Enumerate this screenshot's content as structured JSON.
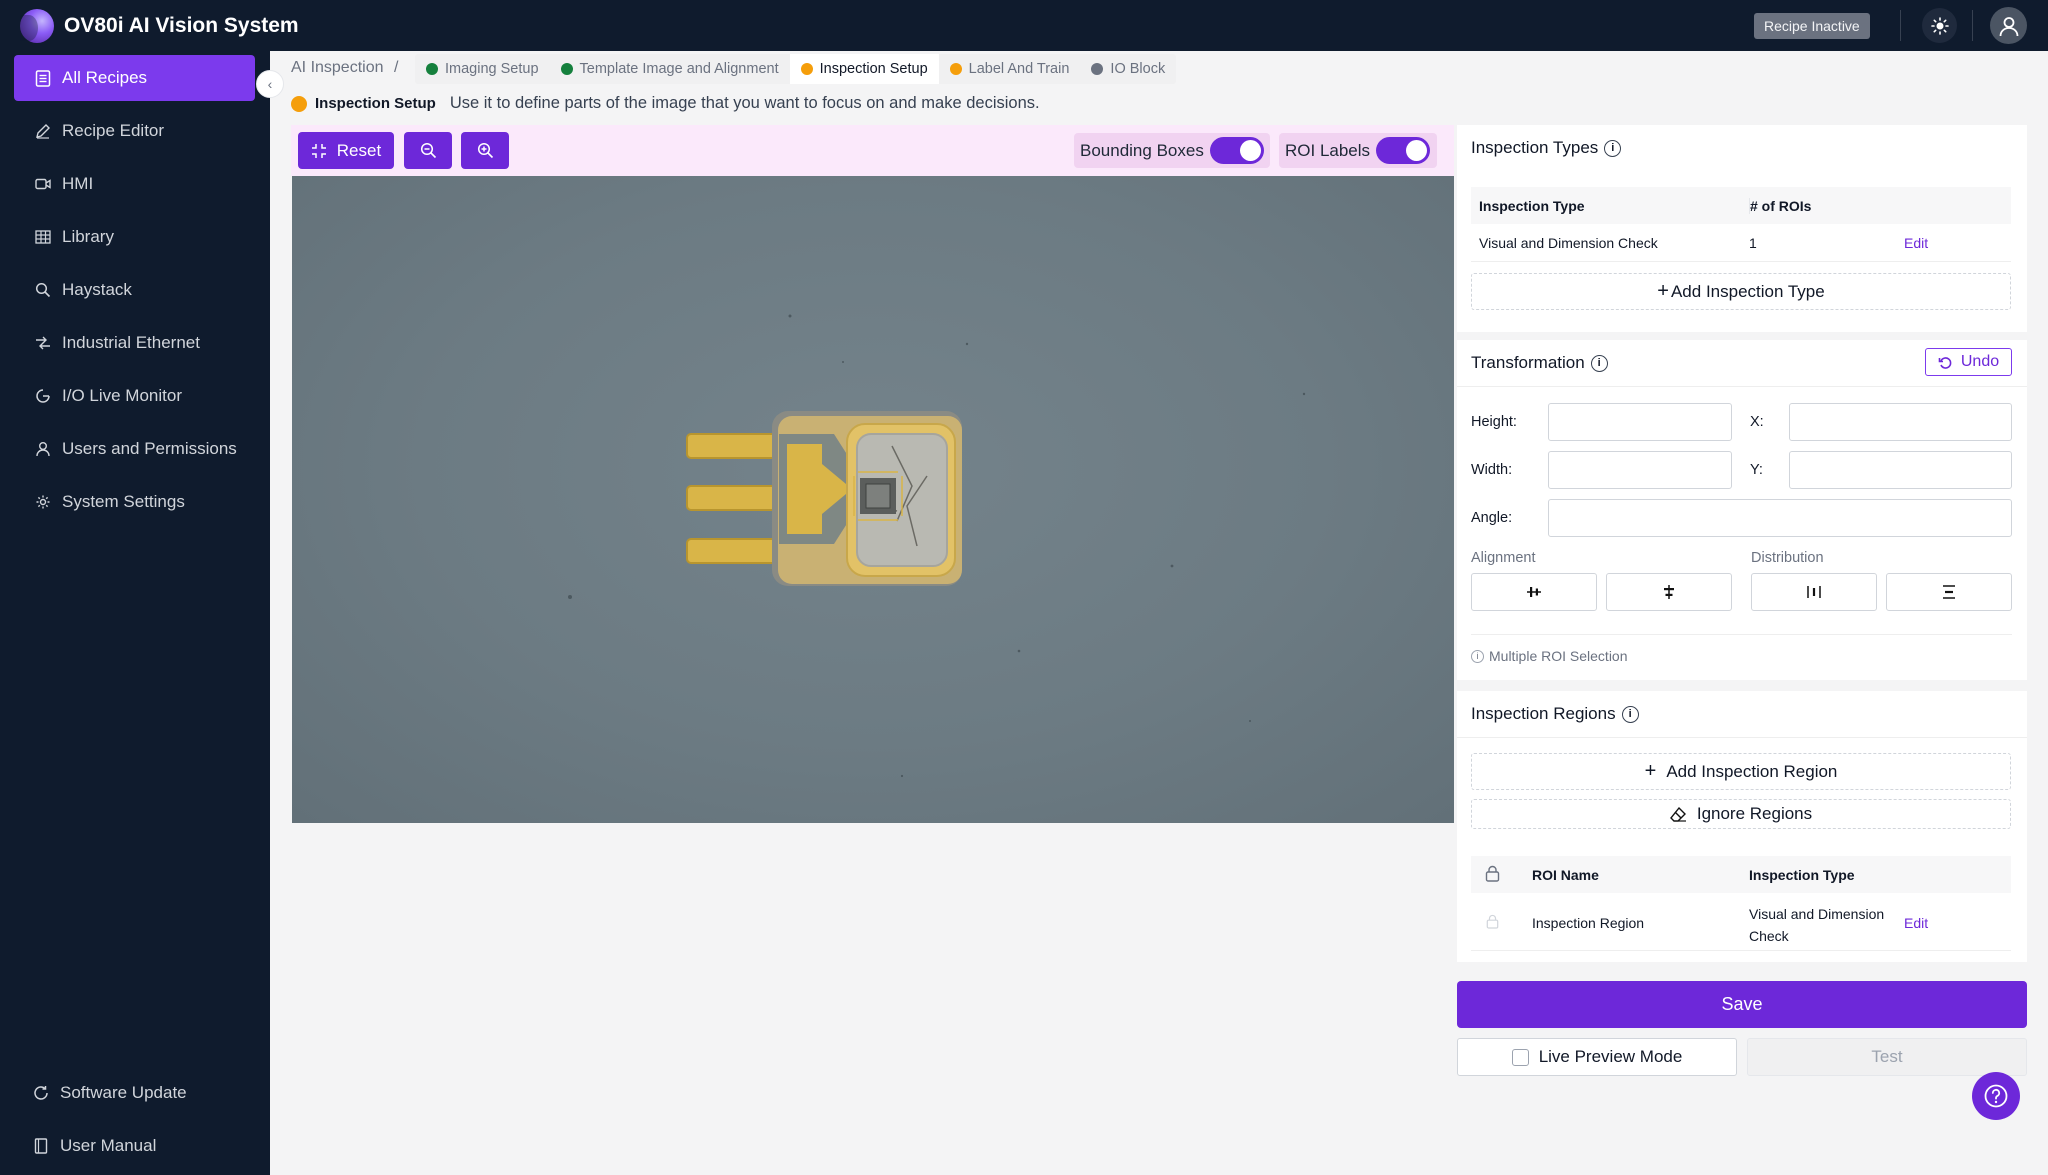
{
  "app": {
    "title": "OV80i AI Vision System",
    "recipe_status": "Recipe Inactive"
  },
  "sidebar": {
    "items": [
      {
        "label": "All Recipes",
        "icon": "list-icon",
        "active": true
      },
      {
        "label": "Recipe Editor",
        "icon": "pencil-icon"
      },
      {
        "label": "HMI",
        "icon": "video-icon"
      },
      {
        "label": "Library",
        "icon": "grid-icon"
      },
      {
        "label": "Haystack",
        "icon": "search-icon"
      },
      {
        "label": "Industrial Ethernet",
        "icon": "network-icon"
      },
      {
        "label": "I/O Live Monitor",
        "icon": "gauge-icon"
      },
      {
        "label": "Users and Permissions",
        "icon": "user-icon"
      },
      {
        "label": "System Settings",
        "icon": "gear-icon"
      }
    ],
    "bottom": [
      {
        "label": "Software Update",
        "icon": "refresh-icon"
      },
      {
        "label": "User Manual",
        "icon": "book-icon"
      }
    ]
  },
  "breadcrumb": {
    "root": "AI Inspection",
    "separator": "/",
    "steps": [
      {
        "label": "Imaging Setup",
        "color": "#15803d"
      },
      {
        "label": "Template Image and Alignment",
        "color": "#15803d"
      },
      {
        "label": "Inspection Setup",
        "color": "#f59e0b",
        "current": true
      },
      {
        "label": "Label And Train",
        "color": "#f59e0b"
      },
      {
        "label": "IO Block",
        "color": "#6b7280"
      }
    ]
  },
  "info": {
    "label": "Inspection Setup",
    "text": "Use it to define parts of the image that you want to focus on and make decisions."
  },
  "toolbar": {
    "reset": "Reset",
    "bounding_boxes": "Bounding Boxes",
    "roi_labels": "ROI Labels"
  },
  "inspection_types": {
    "title": "Inspection Types",
    "headers": [
      "Inspection Type",
      "# of ROIs"
    ],
    "rows": [
      {
        "type": "Visual and Dimension Check",
        "count": "1",
        "action": "Edit"
      }
    ],
    "add_button": "Add Inspection Type"
  },
  "transformation": {
    "title": "Transformation",
    "undo": "Undo",
    "height_label": "Height:",
    "width_label": "Width:",
    "x_label": "X:",
    "y_label": "Y:",
    "angle_label": "Angle:",
    "alignment_label": "Alignment",
    "distribution_label": "Distribution",
    "multi_roi": "Multiple ROI Selection"
  },
  "inspection_regions": {
    "title": "Inspection Regions",
    "add_button": "Add Inspection Region",
    "ignore_button": "Ignore Regions",
    "headers": [
      "ROI Name",
      "Inspection Type"
    ],
    "rows": [
      {
        "name": "Inspection Region",
        "type_line1": "Visual and Dimension",
        "type_line2": "Check",
        "action": "Edit"
      }
    ]
  },
  "actions": {
    "save": "Save",
    "live_preview": "Live Preview Mode",
    "test": "Test"
  }
}
